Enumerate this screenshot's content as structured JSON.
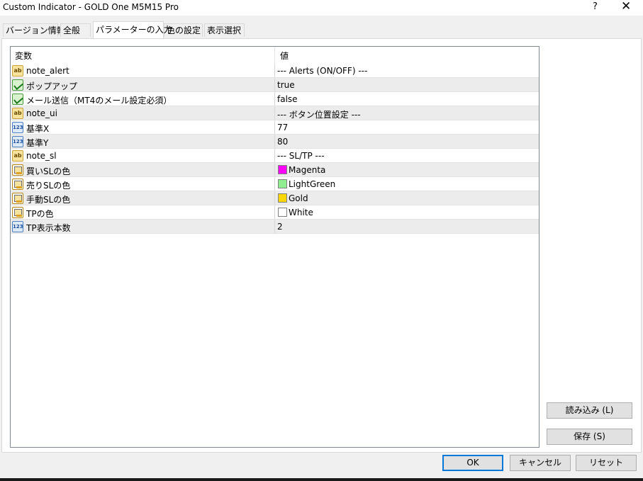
{
  "window": {
    "title": "Custom Indicator - GOLD One M5M15 Pro",
    "help_label": "?",
    "close_label": "✕"
  },
  "tabs": [
    {
      "label": "バージョン情報"
    },
    {
      "label": "全般"
    },
    {
      "label": "パラメーターの入力"
    },
    {
      "label": "色の設定"
    },
    {
      "label": "表示選択"
    }
  ],
  "active_tab": "パラメーターの入力",
  "grid": {
    "col_variable": "変数",
    "col_value": "値",
    "rows": [
      {
        "type": "string",
        "icon": "string-type-icon",
        "name": "note_alert",
        "value": "--- Alerts (ON/OFF) ---"
      },
      {
        "type": "bool",
        "icon": "boolean-type-icon",
        "name": "ポップアップ",
        "value": "true"
      },
      {
        "type": "bool",
        "icon": "boolean-type-icon",
        "name": "メール送信（MT4のメール設定必須）",
        "value": "false"
      },
      {
        "type": "string",
        "icon": "string-type-icon",
        "name": "note_ui",
        "value": "--- ボタン位置設定 ---"
      },
      {
        "type": "int",
        "icon": "integer-type-icon",
        "name": "基準X",
        "value": "77"
      },
      {
        "type": "int",
        "icon": "integer-type-icon",
        "name": "基準Y",
        "value": "80"
      },
      {
        "type": "string",
        "icon": "string-type-icon",
        "name": "note_sl",
        "value": "--- SL/TP ---"
      },
      {
        "type": "color",
        "icon": "color-type-icon",
        "name": "買いSLの色",
        "value": "Magenta",
        "swatch": "#ff00ff"
      },
      {
        "type": "color",
        "icon": "color-type-icon",
        "name": "売りSLの色",
        "value": "LightGreen",
        "swatch": "#90ee90"
      },
      {
        "type": "color",
        "icon": "color-type-icon",
        "name": "手動SLの色",
        "value": "Gold",
        "swatch": "#ffd700"
      },
      {
        "type": "color",
        "icon": "color-type-icon",
        "name": "TPの色",
        "value": "White",
        "swatch": "#ffffff"
      },
      {
        "type": "int",
        "icon": "integer-type-icon",
        "name": "TP表示本数",
        "value": "2"
      }
    ]
  },
  "buttons": {
    "load": "読み込み (L)",
    "save": "保存 (S)",
    "ok": "OK",
    "cancel": "キャンセル",
    "reset": "リセット"
  },
  "colors": {
    "accent": "#0078d7",
    "row_alt": "#ececec"
  }
}
